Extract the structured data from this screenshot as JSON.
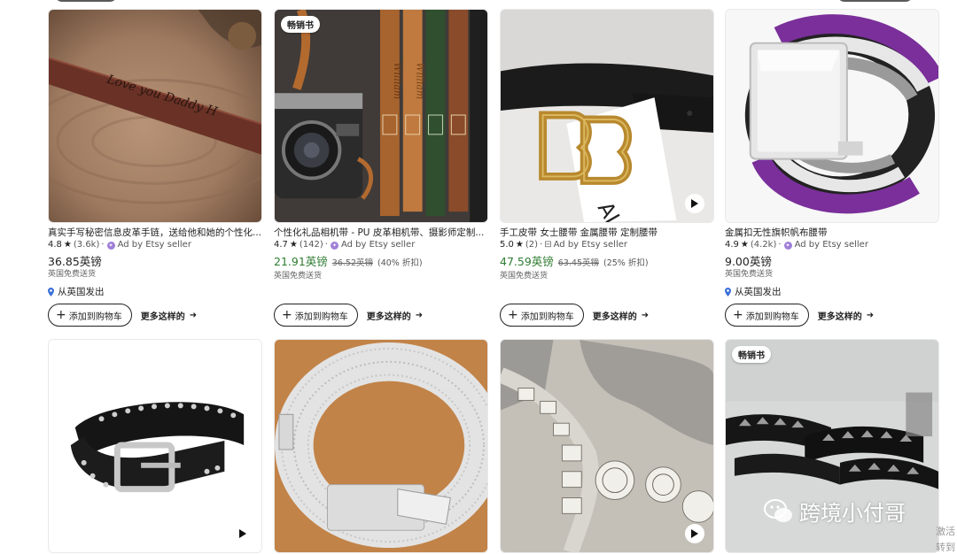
{
  "row1": [
    {
      "title": "真实手写秘密信息皮革手链，送给他和她的个性化...",
      "rating": "4.8",
      "reviews": "(3.6k)",
      "ad_text": "Ad by Etsy seller",
      "price": "36.85英镑",
      "shipping": "英国免费送货",
      "from": "从英国发出"
    },
    {
      "badge": "畅销书",
      "title": "个性化礼品相机带 - PU 皮革相机带、摄影师定制...",
      "rating": "4.7",
      "reviews": "(142)",
      "ad_text": "Ad by Etsy seller",
      "price": "21.91英镑",
      "original_price": "36.52英镑",
      "discount": "(40% 折扣)",
      "shipping": "英国免费送货"
    },
    {
      "title": "手工皮带 女士腰带 金属腰带 定制腰带",
      "rating": "5.0",
      "reviews": "(2)",
      "ad_text": "Ad by Etsy seller",
      "price": "47.59英镑",
      "original_price": "63.45英镑",
      "discount": "(25% 折扣)",
      "shipping": "英国免费送货"
    },
    {
      "title": "金属扣无性旗帜帆布腰带",
      "rating": "4.9",
      "reviews": "(4.2k)",
      "ad_text": "Ad by Etsy seller",
      "price": "9.00英镑",
      "shipping": "英国免费送货",
      "from": "从英国发出"
    }
  ],
  "row2": [
    {},
    {},
    {},
    {
      "badge": "畅销书"
    }
  ],
  "buttons": {
    "add_to_cart": "添加到购物车",
    "more_like_this": "更多这样的"
  },
  "watermark": "跨境小付哥",
  "edge_text": [
    "激活",
    "转到"
  ],
  "colors": {
    "sale_price": "#2f7d32",
    "ad_icon": "#9f7fd9",
    "location_pin": "#3a6fd8"
  },
  "icons": [
    "star-icon",
    "ad-icon",
    "shop-icon",
    "location-pin-icon",
    "plus-icon",
    "arrow-right-icon",
    "play-icon",
    "wechat-icon"
  ]
}
